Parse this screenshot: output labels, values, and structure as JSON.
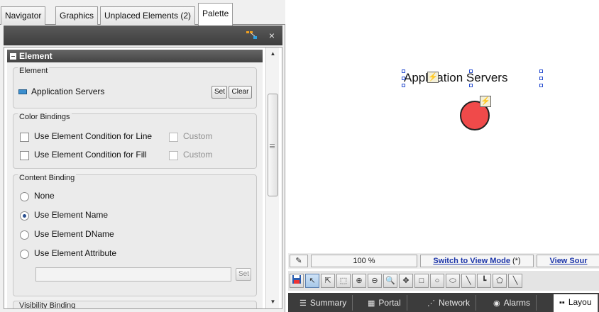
{
  "tabs": [
    {
      "label": "Navigator"
    },
    {
      "label": "Graphics"
    },
    {
      "label": "Unplaced Elements (2)"
    },
    {
      "label": "Palette"
    }
  ],
  "panel": {
    "close_glyph": "×",
    "section_title": "Element",
    "element_group": {
      "title": "Element",
      "element_name": "Application Servers",
      "set_label": "Set",
      "clear_label": "Clear"
    },
    "color_group": {
      "title": "Color Bindings",
      "line_label": "Use Element Condition for Line",
      "fill_label": "Use Element Condition for Fill",
      "custom_label": "Custom"
    },
    "content_group": {
      "title": "Content Binding",
      "options": [
        "None",
        "Use Element Name",
        "Use Element DName",
        "Use Element Attribute"
      ],
      "selected": "Use Element Name",
      "set_label": "Set"
    },
    "visibility_group": {
      "title": "Visibility Binding"
    }
  },
  "canvas": {
    "node_label": "Application Servers",
    "node_color": "#f04a4a"
  },
  "infobar": {
    "zoom": "100 %",
    "switch_link": "Switch to View Mode",
    "switch_suffix": "(*)",
    "view_source": "View Sour"
  },
  "bottom_tabs": [
    {
      "label": "Summary",
      "icon": "summary-icon"
    },
    {
      "label": "Portal",
      "icon": "portal-icon"
    },
    {
      "label": "Network",
      "icon": "network-icon"
    },
    {
      "label": "Alarms",
      "icon": "alarms-icon"
    },
    {
      "label": "Layou",
      "icon": "layout-icon"
    }
  ],
  "colors": {
    "accent": "#1a33a8",
    "header": "#444444"
  }
}
